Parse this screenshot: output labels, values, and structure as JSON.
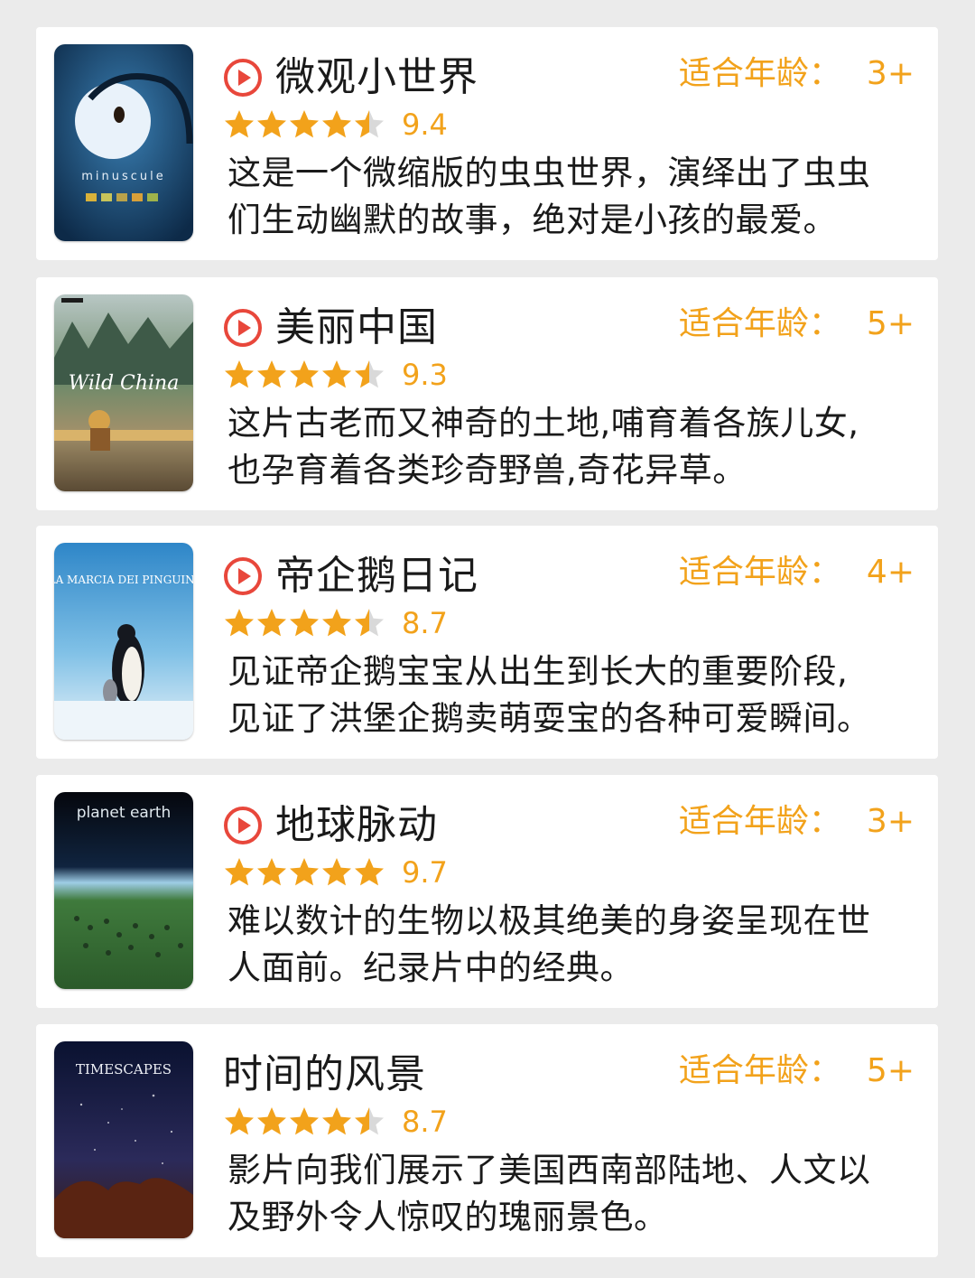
{
  "colors": {
    "accent": "#f2a21b",
    "play_icon": "#e8473b",
    "star": "#f2a21b",
    "star_empty": "#d9d9d9"
  },
  "age_label": "适合年龄",
  "age_colon": "：",
  "movies": [
    {
      "title": "微观小世界",
      "has_play_icon": true,
      "age": "3+",
      "stars": 4.5,
      "score": "9.4",
      "desc_lines": [
        "这是一个微缩版的虫虫世界，演绎出了虫虫",
        "们生动幽默的故事，绝对是小孩的最爱。"
      ],
      "poster_text": "minuscule"
    },
    {
      "title": "美丽中国",
      "has_play_icon": true,
      "age": "5+",
      "stars": 4.5,
      "score": "9.3",
      "desc_lines": [
        "这片古老而又神奇的土地,哺育着各族儿女,",
        "也孕育着各类珍奇野兽,奇花异草。"
      ],
      "poster_text": "Wild China"
    },
    {
      "title": "帝企鹅日记",
      "has_play_icon": true,
      "age": "4+",
      "stars": 4.5,
      "score": "8.7",
      "desc_lines": [
        "见证帝企鹅宝宝从出生到长大的重要阶段,",
        "见证了洪堡企鹅卖萌耍宝的各种可爱瞬间。"
      ],
      "poster_text": "LA MARCIA DEI PINGUINI"
    },
    {
      "title": "地球脉动",
      "has_play_icon": true,
      "age": "3+",
      "stars": 5,
      "score": "9.7",
      "desc_lines": [
        "难以数计的生物以极其绝美的身姿呈现在世",
        "人面前。纪录片中的经典。"
      ],
      "poster_text": "planet earth"
    },
    {
      "title": "时间的风景",
      "has_play_icon": false,
      "age": "5+",
      "stars": 4.5,
      "score": "8.7",
      "desc_lines": [
        "影片向我们展示了美国西南部陆地、人文以",
        "及野外令人惊叹的瑰丽景色。"
      ],
      "poster_text": "TIMESCAPES"
    }
  ]
}
